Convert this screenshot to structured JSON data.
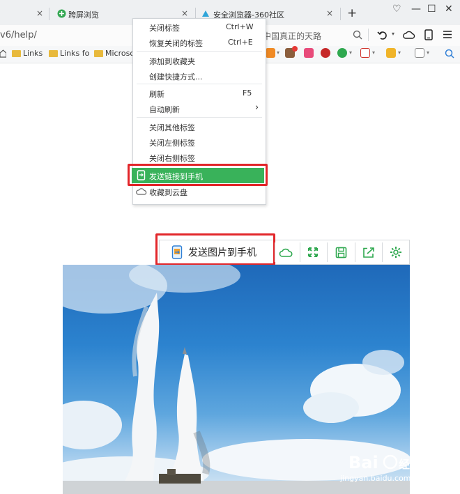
{
  "tabs": [
    {
      "label": "",
      "close": "×"
    },
    {
      "label": "跨屏浏览",
      "close": "×"
    },
    {
      "label": "安全浏览器-360社区",
      "close": "×"
    }
  ],
  "new_tab": "+",
  "window_controls": {
    "skin": "♡",
    "minimize": "—",
    "maximize": "☐",
    "close": "✕"
  },
  "address": {
    "url": "v6/help/",
    "search_placeholder": "中国真正的天路"
  },
  "bookmarks": [
    "Links",
    "Links fo",
    "Microso"
  ],
  "context_menu": {
    "items": [
      {
        "label": "关闭标签",
        "shortcut": "Ctrl+W"
      },
      {
        "label": "恢复关闭的标签",
        "shortcut": "Ctrl+E"
      },
      {
        "label": "添加到收藏夹",
        "shortcut": ""
      },
      {
        "label": "创建快捷方式...",
        "shortcut": ""
      },
      {
        "label": "刷新",
        "shortcut": "F5"
      },
      {
        "label": "自动刷新",
        "shortcut": "›"
      },
      {
        "label": "关闭其他标签",
        "shortcut": ""
      },
      {
        "label": "关闭左侧标签",
        "shortcut": ""
      },
      {
        "label": "关闭右侧标签",
        "shortcut": ""
      },
      {
        "label": "发送链接到手机",
        "shortcut": ""
      },
      {
        "label": "收藏到云盘",
        "shortcut": ""
      }
    ]
  },
  "image_toolbar": {
    "send_label": "发送图片到手机"
  },
  "watermark": {
    "brand": "Bai",
    "brand_cn": "经验",
    "url": "jingyan.baidu.com"
  },
  "colors": {
    "highlight": "#39b25a",
    "callout": "#e2262a",
    "icon_green": "#2fa84f"
  }
}
